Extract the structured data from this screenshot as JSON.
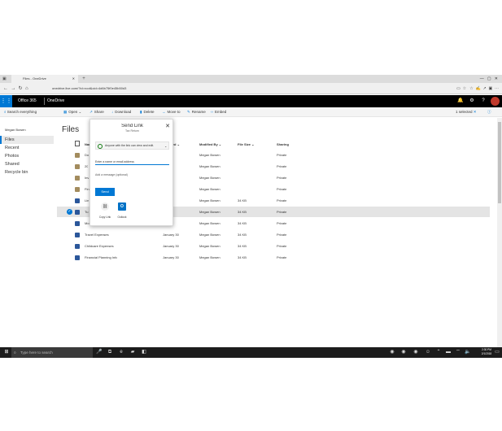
{
  "browser": {
    "tab_title": "Files - OneDrive",
    "url": "onedrive.live.com/?id=root&cid=4d6b75f0e45b50d3"
  },
  "o365": {
    "app_launcher_label": "Office 365",
    "app_name": "OneDrive"
  },
  "search": {
    "label": "Search everything"
  },
  "commands": [
    {
      "label": "Open",
      "icon": "✎"
    },
    {
      "label": "Share",
      "icon": "↗"
    },
    {
      "label": "Download",
      "icon": "↓"
    },
    {
      "label": "Delete",
      "icon": "🗑"
    },
    {
      "label": "Move to",
      "icon": "→"
    },
    {
      "label": "Rename",
      "icon": "✎"
    },
    {
      "label": "Embed",
      "icon": "‹›"
    }
  ],
  "selection": {
    "count_label": "1 selected"
  },
  "sidebar": {
    "user": "Megan Bowen",
    "items": [
      {
        "label": "Files"
      },
      {
        "label": "Recent"
      },
      {
        "label": "Photos"
      },
      {
        "label": "Shared"
      },
      {
        "label": "Recycle bin"
      }
    ]
  },
  "main": {
    "title": "Files",
    "columns": {
      "name": "Name",
      "modified": "Modified",
      "modified_by": "Modified By",
      "file_size": "File Size",
      "sharing": "Sharing"
    },
    "rows": [
      {
        "name": "Do",
        "modified": "30",
        "modified_by": "Megan Bowen",
        "file_size": "",
        "sharing": "Private",
        "type": "folder"
      },
      {
        "name": "20",
        "modified": "30",
        "modified_by": "Megan Bowen",
        "file_size": "",
        "sharing": "Private",
        "type": "folder"
      },
      {
        "name": "Inv",
        "modified": "30",
        "modified_by": "Megan Bowen",
        "file_size": "",
        "sharing": "Private",
        "type": "folder"
      },
      {
        "name": "Fin",
        "modified": "30",
        "modified_by": "Megan Bowen",
        "file_size": "",
        "sharing": "Private",
        "type": "folder"
      },
      {
        "name": "Lin",
        "modified": "30",
        "modified_by": "Megan Bowen",
        "file_size": "34 KB",
        "sharing": "Private",
        "type": "doc"
      },
      {
        "name": "Tu",
        "modified": "30",
        "modified_by": "Megan Bowen",
        "file_size": "34 KB",
        "sharing": "Private",
        "type": "doc"
      },
      {
        "name": "Mo",
        "modified": "30",
        "modified_by": "Megan Bowen",
        "file_size": "34 KB",
        "sharing": "Private",
        "type": "doc"
      },
      {
        "name": "Travel Expenses",
        "modified": "January 30",
        "modified_by": "Megan Bowen",
        "file_size": "34 KB",
        "sharing": "Private",
        "type": "doc"
      },
      {
        "name": "Childcare Expenses",
        "modified": "January 30",
        "modified_by": "Megan Bowen",
        "file_size": "34 KB",
        "sharing": "Private",
        "type": "doc"
      },
      {
        "name": "Financial Planning Info",
        "modified": "January 30",
        "modified_by": "Megan Bowen",
        "file_size": "34 KB",
        "sharing": "Private",
        "type": "doc"
      }
    ]
  },
  "share_dialog": {
    "title": "Send Link",
    "subtitle": "Tax Return",
    "permission": "Anyone with the link can view and edit.",
    "email_placeholder": "Enter a name or email address",
    "message_placeholder": "Add a message (optional)",
    "send_label": "Send",
    "options": [
      {
        "label": "Copy Link",
        "icon": "⛓"
      },
      {
        "label": "Outlook",
        "icon": "O"
      }
    ]
  },
  "taskbar": {
    "search_placeholder": "Type here to search",
    "time": "2:30 PM",
    "date": "2/1/2018"
  },
  "colors": {
    "accent": "#0078d4",
    "o365_bar": "#000000",
    "taskbar": "#1c1c1c"
  }
}
